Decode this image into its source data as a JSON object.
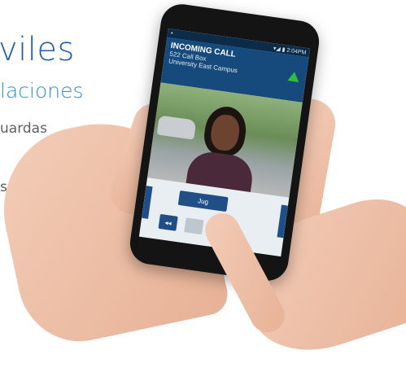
{
  "hero": {
    "title": "viles",
    "subtitle": "laciones",
    "line1": "uardas",
    "line2": "s."
  },
  "phone": {
    "status_right": "▾◢ ▮ 2:04PM",
    "call_title": "INCOMING CALL",
    "call_source": "522 Call Box",
    "call_location": "University East Campus",
    "main_button": "Jug",
    "small_button": "◂◂",
    "hang_icon": "hangup-icon"
  }
}
